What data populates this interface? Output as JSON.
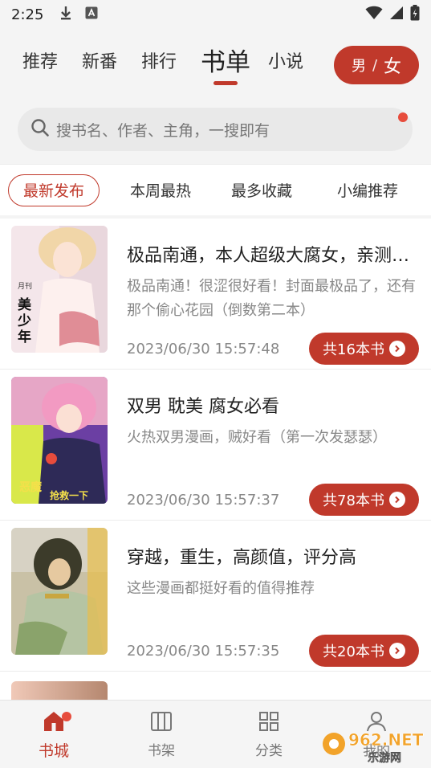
{
  "status_bar": {
    "time": "2:25"
  },
  "tabs": [
    {
      "label": "推荐"
    },
    {
      "label": "新番"
    },
    {
      "label": "排行"
    },
    {
      "label": "书单"
    },
    {
      "label": "小说"
    }
  ],
  "gender_switch": {
    "male": "男",
    "separator": "/",
    "female": "女"
  },
  "search": {
    "placeholder": "搜书名、作者、主角，一搜即有"
  },
  "filters": [
    {
      "label": "最新发布"
    },
    {
      "label": "本周最热"
    },
    {
      "label": "最多收藏"
    },
    {
      "label": "小编推荐"
    }
  ],
  "booklists": [
    {
      "title": "极品南通，本人超级大腐女，亲测…",
      "desc": "极品南通！很涩很好看！封面最极品了，还有那个偷心花园（倒数第二本）",
      "date": "2023/06/30 15:57:48",
      "count": "共16本书",
      "cover_text": "美少年",
      "cover_small": "月刊"
    },
    {
      "title": "双男 耽美 腐女必看",
      "desc": "火热双男漫画，贼好看（第一次发瑟瑟）",
      "date": "2023/06/30 15:57:37",
      "count": "共78本书",
      "cover_text": "恶魔想要抢救一下"
    },
    {
      "title": "穿越，重生，高颜值，评分高",
      "desc": "这些漫画都挺好看的值得推荐",
      "date": "2023/06/30 15:57:35",
      "count": "共20本书"
    }
  ],
  "bottom_nav": [
    {
      "label": "书城",
      "icon": "home-icon"
    },
    {
      "label": "书架",
      "icon": "bookshelf-icon"
    },
    {
      "label": "分类",
      "icon": "category-icon"
    },
    {
      "label": "我的",
      "icon": "profile-icon"
    }
  ],
  "watermark": {
    "text": "962.NET",
    "sub": "乐游网"
  },
  "colors": {
    "accent": "#c0392b",
    "badge": "#e74c3c"
  }
}
